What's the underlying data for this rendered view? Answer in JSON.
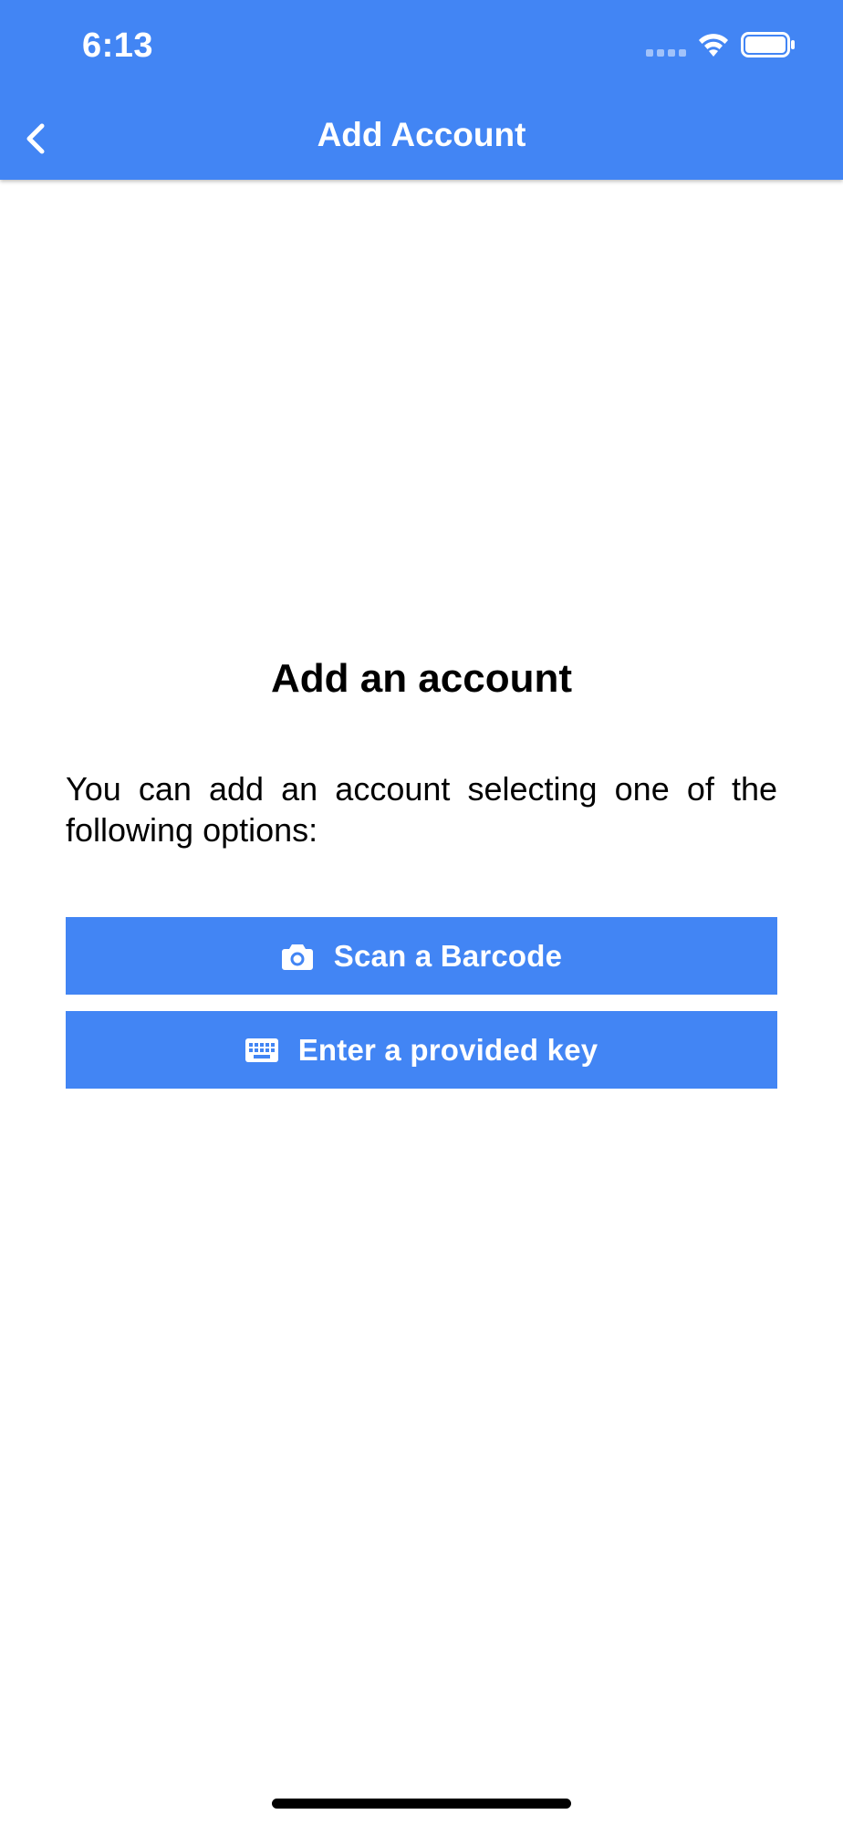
{
  "status_bar": {
    "time": "6:13"
  },
  "header": {
    "title": "Add Account",
    "back_icon": "chevron-left-icon"
  },
  "main": {
    "title": "Add an account",
    "description": "You can add an account selecting one of the following options:"
  },
  "actions": {
    "scan": {
      "label": "Scan a Barcode",
      "icon": "camera-icon"
    },
    "key": {
      "label": "Enter a provided key",
      "icon": "keyboard-icon"
    }
  },
  "colors": {
    "primary": "#4285f4",
    "on_primary": "#ffffff",
    "text": "#000000",
    "background": "#ffffff"
  }
}
